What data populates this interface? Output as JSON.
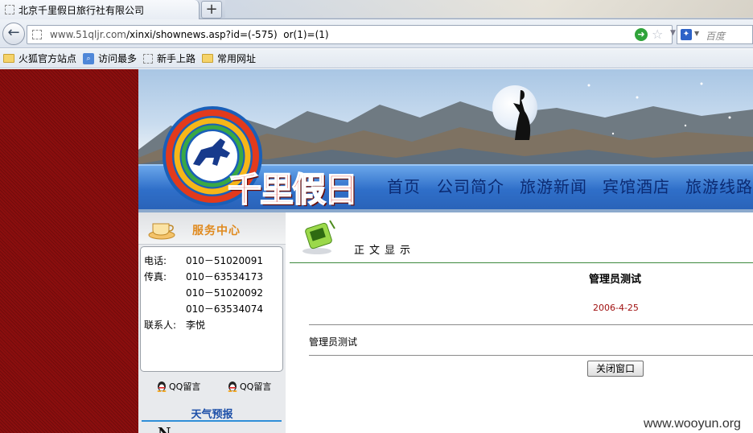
{
  "browser": {
    "tab_title": "北京千里假日旅行社有限公司",
    "new_tab": "+",
    "url_domain": "www.51qljr.com",
    "url_path": "/xinxi/shownews.asp?id=(-575)  or(1)=(1)",
    "search_placeholder": "百度",
    "bookmarks": [
      {
        "label": "火狐官方站点",
        "icon": "folder-icon"
      },
      {
        "label": "访问最多",
        "icon": "search-icon"
      },
      {
        "label": "新手上路",
        "icon": "blank-page-icon"
      },
      {
        "label": "常用网址",
        "icon": "folder-icon"
      }
    ]
  },
  "site": {
    "logo_text": "千里假日",
    "nav": [
      "首页",
      "公司简介",
      "旅游新闻",
      "宾馆酒店",
      "旅游线路"
    ]
  },
  "service": {
    "title": "服务中心",
    "contacts": [
      {
        "label": "电话:",
        "value": "010－51020091"
      },
      {
        "label": "传真:",
        "value": "010－63534173"
      },
      {
        "label": "",
        "value": "010－51020092"
      },
      {
        "label": "",
        "value": "010－63534074"
      },
      {
        "label": "联系人:",
        "value": "李悦"
      }
    ],
    "qq_label": "QQ留言",
    "weather_title": "天气预报"
  },
  "article": {
    "section_title": "正文显示",
    "title": "管理员测试",
    "date": "2006-4-25",
    "body": "管理员测试",
    "close_button": "关闭窗口"
  },
  "watermark": "www.wooyun.org",
  "colors": {
    "left_background": "#8b0e0e",
    "nav_strip": "#2f6fc9",
    "nav_text": "#0b2a72",
    "logo_text": "#d31b12",
    "service_title": "#e08a1e",
    "date_text": "#a01010"
  }
}
